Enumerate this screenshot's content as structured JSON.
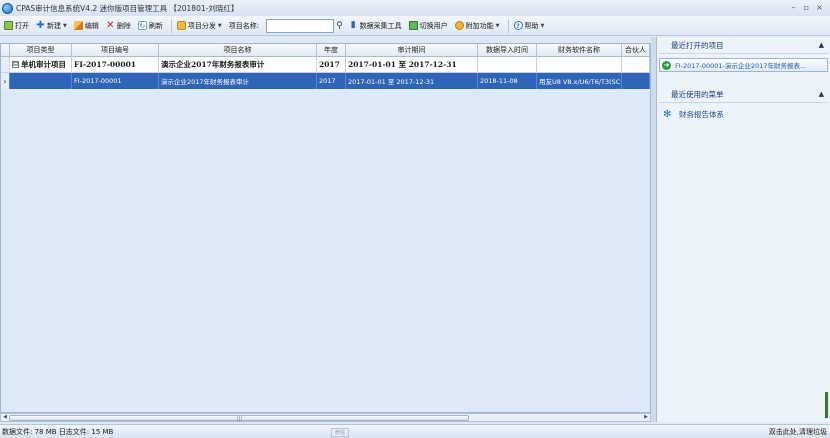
{
  "window": {
    "title": "CPAS审计信息系统V4.2 迷你版项目管理工具 【201801-刘晓红】",
    "minimize": "–",
    "restore": "▫",
    "close": "×"
  },
  "toolbar": {
    "open": "打开",
    "new": "新建",
    "edit": "编辑",
    "delete": "删除",
    "refresh": "刷新",
    "project_share": "项目分发",
    "project_name_label": "项目名称:",
    "search_value": "",
    "data_collect": "数据采集工具",
    "switch_user": "切换用户",
    "addon": "附加功能",
    "help": "帮助"
  },
  "grid": {
    "columns": [
      "项目类型",
      "项目编号",
      "项目名称",
      "年度",
      "审计期间",
      "数据导入时间",
      "财务软件名称",
      "合伙人"
    ],
    "group_row": {
      "expander": "⊟",
      "type": "单机审计项目",
      "code": "FI-2017-00001",
      "name": "演示企业2017年财务报表审计",
      "year": "2017",
      "period": "2017-01-01 至 2017-12-31",
      "import_time": "",
      "software": "",
      "partner": ""
    },
    "rows": [
      {
        "indicator": "›",
        "type": "",
        "code": "FI-2017-00001",
        "name": "演示企业2017年财务报表审计",
        "year": "2017",
        "period": "2017-01-01 至 2017-12-31",
        "import_time": "2018-11-08",
        "software": "用友U8 V8.x/U6/T6/T3(SC",
        "partner": ""
      }
    ]
  },
  "right_panel": {
    "recent_projects_title": "最近打开的项目",
    "recent_projects": [
      "FI-2017-00001-演示企业2017年财务报表..."
    ],
    "recent_menus_title": "最近使用的菜单",
    "recent_menus": [
      "财务报告体系"
    ]
  },
  "statusbar": {
    "left": "数据文件: 78 MB  日志文件: 15 MB",
    "center": "微信",
    "right": "双击此处,清理垃圾"
  },
  "colors": {
    "selected_row": "#2f65b8",
    "window_bg": "#dfe9f5",
    "accent_blue": "#1c4f95"
  },
  "icons": {
    "app": "cpas-app-icon",
    "go": "go-arrow-icon",
    "menu": "report-system-icon"
  }
}
